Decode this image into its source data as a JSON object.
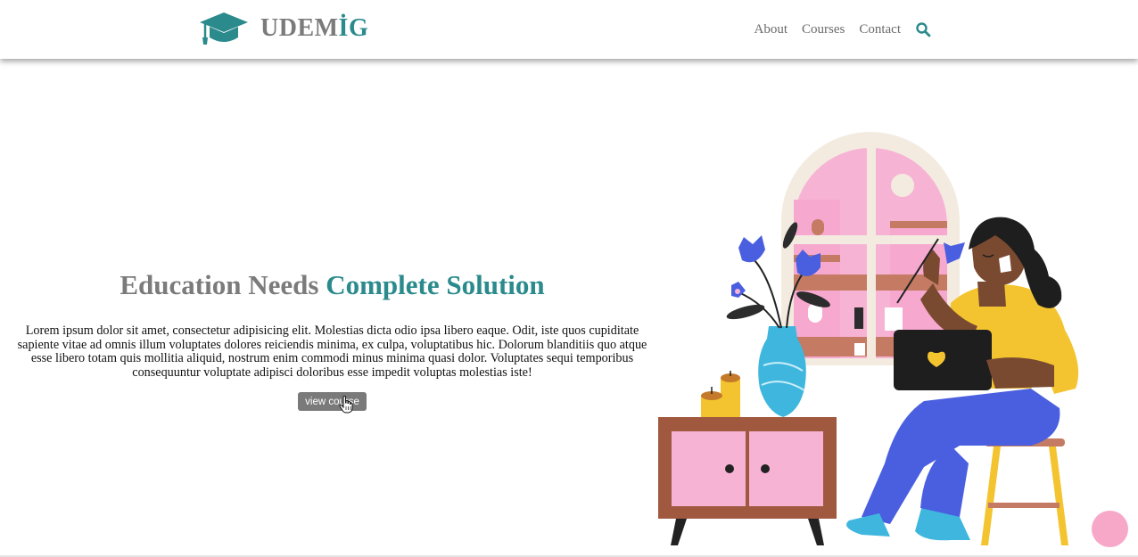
{
  "header": {
    "logo_part1": "UDEM",
    "logo_part2": "İG",
    "nav": [
      "About",
      "Courses",
      "Contact"
    ]
  },
  "hero": {
    "title_part1": "Education Needs",
    "title_part2": "Complete Solution",
    "text": "Lorem ipsum dolor sit amet, consectetur adipisicing elit. Molestias dicta odio ipsa libero eaque. Odit, iste quos cupiditate sapiente vitae ad omnis illum voluptates dolores reiciendis minima, ex culpa, voluptatibus hic. Dolorum blanditiis quo atque esse libero totam quis mollitia aliquid, nostrum enim commodi minus minima quasi dolor. Voluptates sequi temporibus consequuntur voluptate adipisci doloribus esse impedit voluptas molestias iste!",
    "button": "view course"
  },
  "icons": {
    "logo": "graduation-cap-icon",
    "search": "search-icon",
    "cursor": "hand-cursor-icon"
  },
  "colors": {
    "brand_teal": "#2b8a8c",
    "brand_gray": "#7b7b7b",
    "button": "#7a7a7a",
    "fab": "#f7a8c8"
  }
}
